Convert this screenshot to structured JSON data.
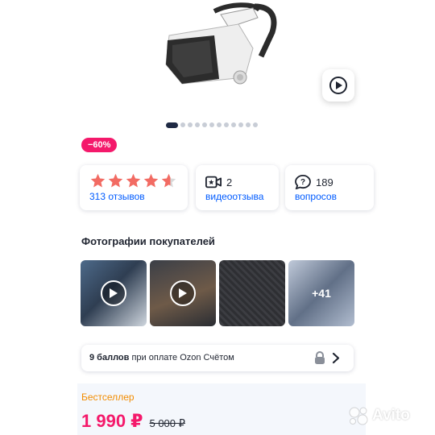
{
  "gallery": {
    "slides_total": 12,
    "active_slide": 1,
    "video_button": "play-icon"
  },
  "product": {
    "discount_label": "−60%",
    "rating": 4.6
  },
  "stats": {
    "reviews_label": "313 отзывов",
    "video_count": "2",
    "video_label": "видеоотзыва",
    "questions_count": "189",
    "questions_label": "вопросов"
  },
  "customer_photos": {
    "title": "Фотографии покупателей",
    "more_label": "+41"
  },
  "bonus": {
    "points": "9 баллов",
    "rest": "при оплате Ozon Счётом"
  },
  "pricing": {
    "badge": "Бестселлер",
    "price": "1 990 ₽",
    "old_price": "5 000 ₽"
  },
  "watermark": {
    "text": "Avito"
  },
  "colors": {
    "accent": "#005bff",
    "price": "#f4196b",
    "badge": "#f28c00",
    "star": "#f26b63"
  }
}
